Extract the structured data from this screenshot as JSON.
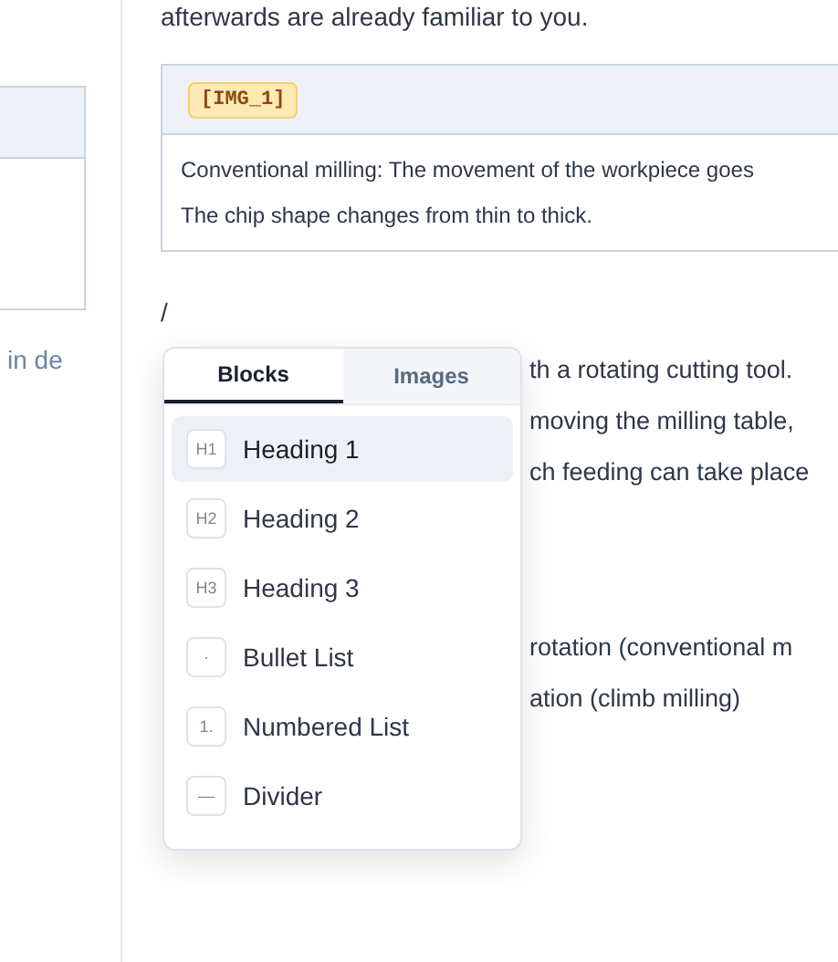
{
  "sidebar": {
    "text": "in de"
  },
  "intro": "afterwards are already familiar to you.",
  "image_block": {
    "badge": "[IMG_1]",
    "caption": [
      "Conventional milling: The movement of the workpiece goes",
      "The chip shape changes from thin to thick."
    ]
  },
  "slash": "/",
  "paragraph_lines": [
    "th a rotating cutting tool.",
    "moving the milling table,",
    "ch feeding can take place"
  ],
  "list_lines": [
    "rotation (conventional m",
    "ation (climb milling)"
  ],
  "menu": {
    "tabs": [
      {
        "label": "Blocks",
        "selected": true
      },
      {
        "label": "Images",
        "selected": false
      }
    ],
    "items": [
      {
        "icon": "H1",
        "label": "Heading 1",
        "selected": true
      },
      {
        "icon": "H2",
        "label": "Heading 2",
        "selected": false
      },
      {
        "icon": "H3",
        "label": "Heading 3",
        "selected": false
      },
      {
        "icon": "·",
        "label": "Bullet List",
        "selected": false
      },
      {
        "icon": "1.",
        "label": "Numbered List",
        "selected": false
      },
      {
        "icon": "—",
        "label": "Divider",
        "selected": false
      }
    ]
  }
}
